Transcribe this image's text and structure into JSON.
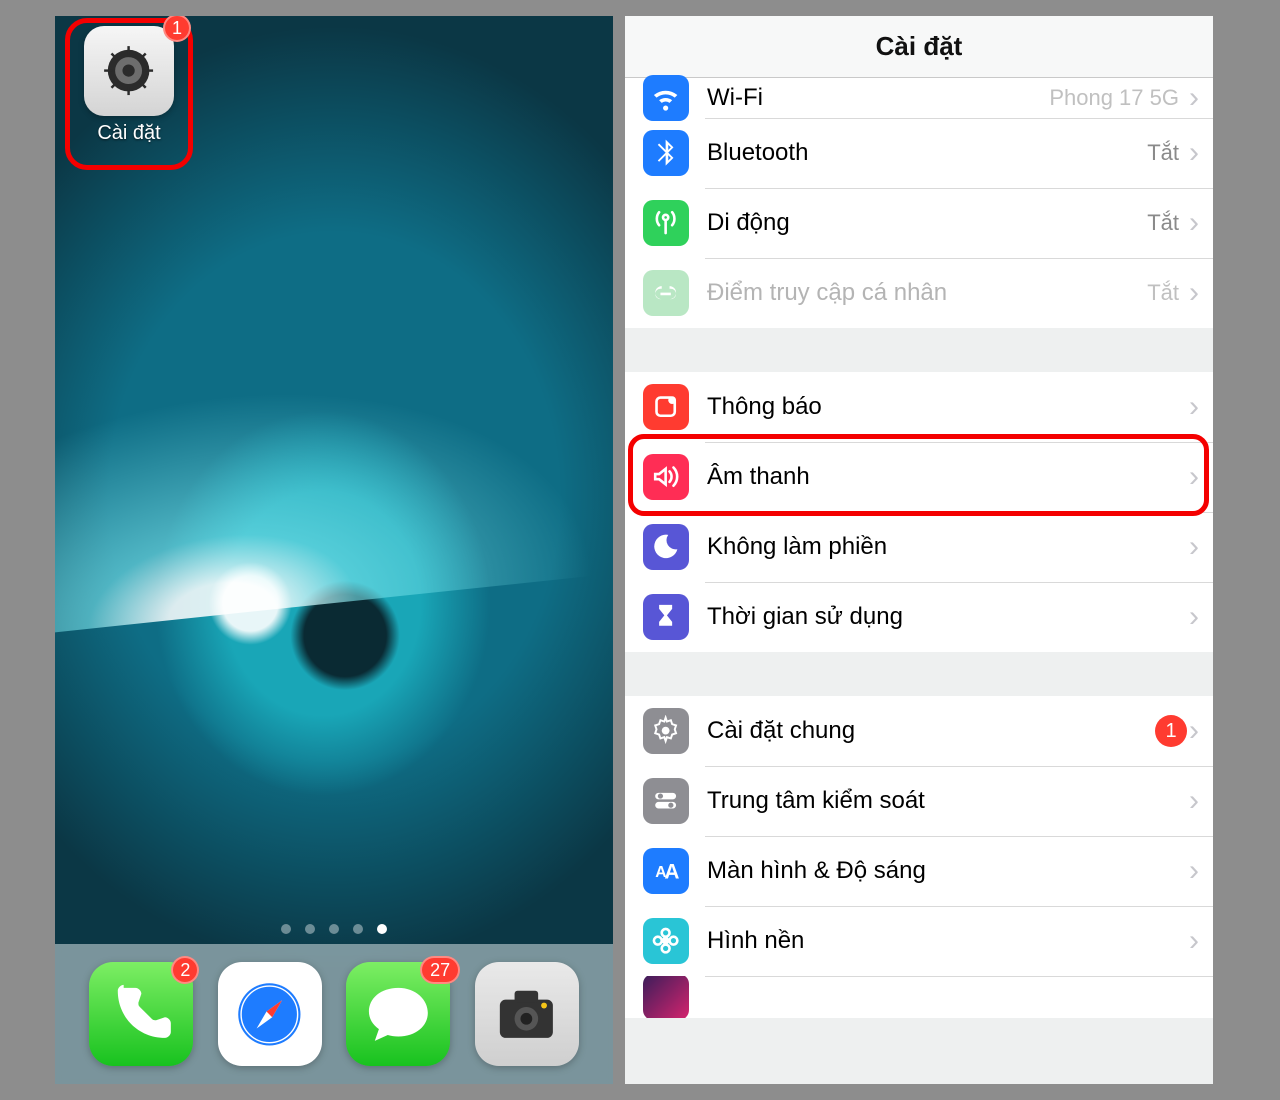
{
  "homescreen": {
    "settings_app": {
      "label": "Cài đặt",
      "badge": "1"
    },
    "page_indicator": {
      "count": 5,
      "active_index": 4
    },
    "dock": {
      "phone_badge": "2",
      "messages_badge": "27"
    }
  },
  "settings": {
    "title": "Cài đặt",
    "group_network": [
      {
        "key": "wifi",
        "label": "Wi-Fi",
        "value": "Phong 17 5G",
        "disabled": false,
        "partial": true
      },
      {
        "key": "bluetooth",
        "label": "Bluetooth",
        "value": "Tắt"
      },
      {
        "key": "cellular",
        "label": "Di động",
        "value": "Tắt"
      },
      {
        "key": "hotspot",
        "label": "Điểm truy cập cá nhân",
        "value": "Tắt",
        "disabled": true
      }
    ],
    "group_notify": [
      {
        "key": "notifications",
        "label": "Thông báo"
      },
      {
        "key": "sounds",
        "label": "Âm thanh",
        "highlight": true
      },
      {
        "key": "dnd",
        "label": "Không làm phiền"
      },
      {
        "key": "screentime",
        "label": "Thời gian sử dụng"
      }
    ],
    "group_general": [
      {
        "key": "general",
        "label": "Cài đặt chung",
        "badge": "1"
      },
      {
        "key": "control",
        "label": "Trung tâm kiểm soát"
      },
      {
        "key": "display",
        "label": "Màn hình & Độ sáng"
      },
      {
        "key": "wallpaper",
        "label": "Hình nền"
      },
      {
        "key": "siri",
        "label": "",
        "partial": true
      }
    ],
    "icon_colors": {
      "wifi": "#1e7cff",
      "bluetooth": "#1e7cff",
      "cellular": "#2fd15b",
      "hotspot": "#b9e7c4",
      "notifications": "#ff3b30",
      "sounds": "#ff2d55",
      "dnd": "#5856d6",
      "screentime": "#5856d6",
      "general": "#8e8e93",
      "control": "#8e8e93",
      "display": "#1e7cff",
      "wallpaper": "#29c5d6",
      "siri": "#1b1b2e"
    }
  }
}
